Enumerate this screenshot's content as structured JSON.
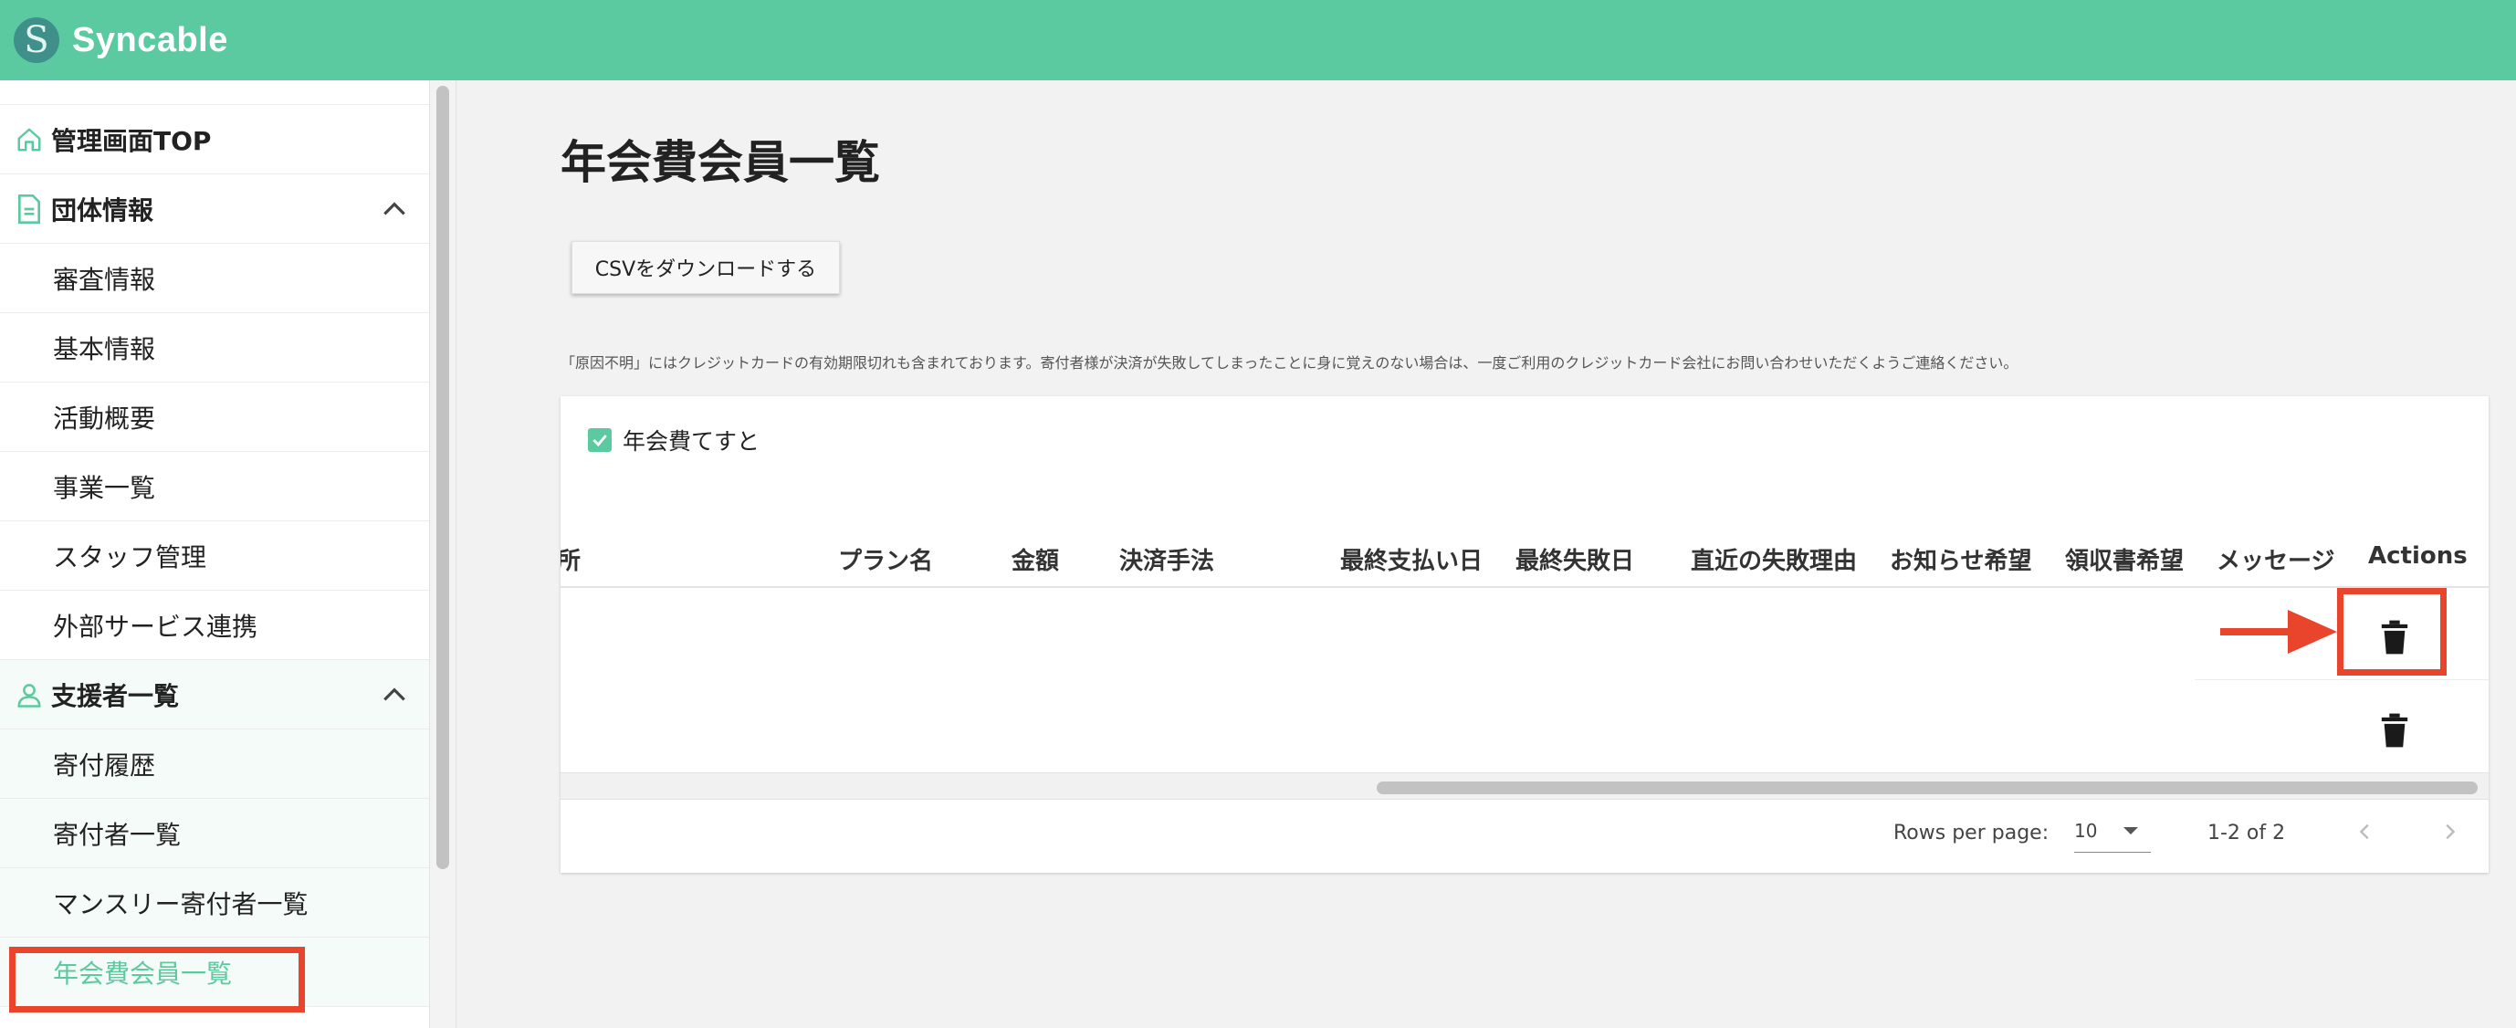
{
  "app": {
    "logo_letter": "S",
    "name": "Syncable"
  },
  "sidebar": {
    "home": {
      "label": "管理画面TOP"
    },
    "section_org": {
      "label": "団体情報"
    },
    "org_items": [
      "審査情報",
      "基本情報",
      "活動概要",
      "事業一覧",
      "スタッフ管理",
      "外部サービス連携"
    ],
    "section_supporters": {
      "label": "支援者一覧"
    },
    "supporter_items": [
      "寄付履歴",
      "寄付者一覧",
      "マンスリー寄付者一覧",
      "年会費会員一覧"
    ],
    "active_item": "年会費会員一覧"
  },
  "main": {
    "title": "年会費会員一覧",
    "csv_button": "CSVをダウンロードする",
    "note": "「原因不明」にはクレジットカードの有効期限切れも含まれております。寄付者様が決済が失敗してしまったことに身に覚えのない場合は、一度ご利用のクレジットカード会社にお問い合わせいただくようご連絡ください。",
    "filter_checkbox": {
      "label": "年会費てすと",
      "checked": true
    },
    "table": {
      "columns": [
        "所",
        "プラン名",
        "金額",
        "決済手法",
        "最終支払い日",
        "最終失敗日",
        "直近の失敗理由",
        "お知らせ希望",
        "領収書希望",
        "メッセージ",
        "Actions"
      ],
      "row_count_shown": 2
    },
    "pagination": {
      "rows_per_page_label": "Rows per page:",
      "rows_per_page_value": "10",
      "range": "1-2 of 2"
    }
  },
  "annotations": {
    "highlight_color": "#e8452c"
  },
  "colors": {
    "brand": "#5ccaa0",
    "logo_mark": "#3f8f8a"
  }
}
